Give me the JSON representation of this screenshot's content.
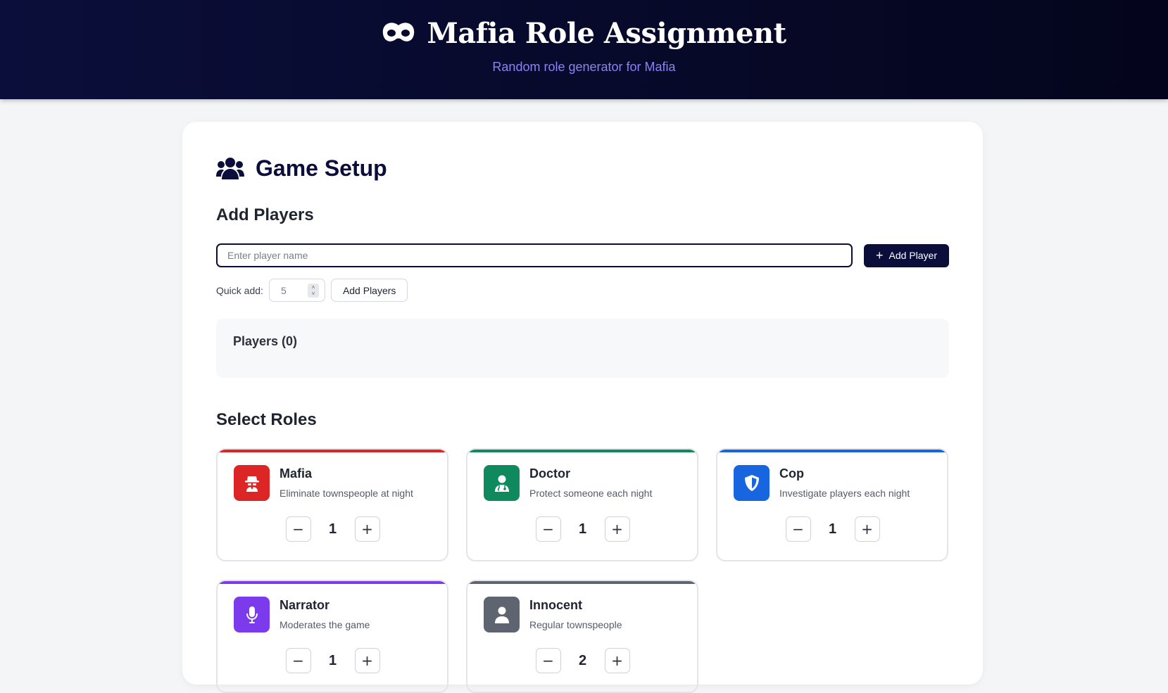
{
  "header": {
    "title": "Mafia Role Assignment",
    "subtitle": "Random role generator for Mafia",
    "icon": "mask-icon"
  },
  "setup": {
    "title": "Game Setup",
    "icon": "users-icon",
    "add_players_title": "Add Players",
    "name_input": {
      "placeholder": "Enter player name",
      "value": ""
    },
    "add_player_button": "Add Player",
    "quick_add": {
      "label": "Quick add:",
      "value": "5",
      "button": "Add Players"
    },
    "players_heading": "Players (0)",
    "select_roles_title": "Select Roles"
  },
  "roles": [
    {
      "name": "Mafia",
      "description": "Eliminate townspeople at night",
      "count": "1",
      "color": "#dc2626",
      "icon": "spy-icon"
    },
    {
      "name": "Doctor",
      "description": "Protect someone each night",
      "count": "1",
      "color": "#0f8a5f",
      "icon": "doctor-icon"
    },
    {
      "name": "Cop",
      "description": "Investigate players each night",
      "count": "1",
      "color": "#1766e0",
      "icon": "shield-icon"
    },
    {
      "name": "Narrator",
      "description": "Moderates the game",
      "count": "1",
      "color": "#7c3aed",
      "icon": "microphone-icon"
    },
    {
      "name": "Innocent",
      "description": "Regular townspeople",
      "count": "2",
      "color": "#5f6570",
      "icon": "user-icon"
    }
  ]
}
